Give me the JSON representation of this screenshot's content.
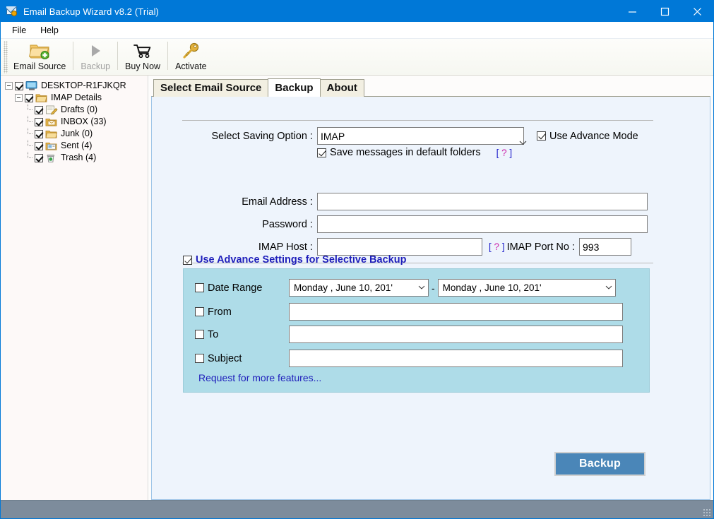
{
  "window": {
    "title": "Email Backup Wizard v8.2 (Trial)",
    "icon": "envelope-app-icon",
    "minimize": "minimize-icon",
    "maximize": "maximize-icon",
    "close": "close-icon",
    "accent_color": "#0078d7"
  },
  "menu": {
    "items": [
      {
        "label": "File"
      },
      {
        "label": "Help"
      }
    ]
  },
  "toolbar": {
    "buttons": [
      {
        "label": "Email Source",
        "icon": "folder-add-icon",
        "disabled": false
      },
      {
        "label": "Backup",
        "icon": "play-triangle-icon",
        "disabled": true
      },
      {
        "label": "Buy Now",
        "icon": "shopping-cart-icon",
        "disabled": false
      },
      {
        "label": "Activate",
        "icon": "key-icon",
        "disabled": false
      }
    ]
  },
  "sidebar": {
    "tree": [
      {
        "label": "DESKTOP-R1FJKQR",
        "icon": "computer-icon",
        "checked": true,
        "level": 0,
        "expander": true
      },
      {
        "label": "IMAP Details",
        "icon": "folders-icon",
        "checked": true,
        "level": 1,
        "expander": true
      },
      {
        "label": "Drafts (0)",
        "icon": "drafts-icon",
        "checked": true,
        "level": 2,
        "expander": false
      },
      {
        "label": "INBOX (33)",
        "icon": "inbox-icon",
        "checked": true,
        "level": 2,
        "expander": false
      },
      {
        "label": "Junk (0)",
        "icon": "folder-icon",
        "checked": true,
        "level": 2,
        "expander": false
      },
      {
        "label": "Sent (4)",
        "icon": "sent-icon",
        "checked": true,
        "level": 2,
        "expander": false
      },
      {
        "label": "Trash (4)",
        "icon": "trash-icon",
        "checked": true,
        "level": 2,
        "expander": false
      }
    ]
  },
  "tabs": [
    {
      "label": "Select Email Source",
      "active": false
    },
    {
      "label": "Backup",
      "active": true
    },
    {
      "label": "About",
      "active": false
    }
  ],
  "form": {
    "saving_option_label": "Select Saving Option :",
    "saving_option_value": "IMAP",
    "use_advance_mode_label": "Use Advance Mode",
    "use_advance_mode_checked": true,
    "save_default_folders_label": "Save messages in default folders",
    "save_default_folders_checked": true,
    "help_bracket_open": "[",
    "help_question": "?",
    "help_bracket_close": "]",
    "email_label": "Email Address :",
    "email_value": "",
    "password_label": "Password :",
    "password_value": "",
    "imap_host_label": "IMAP Host :",
    "imap_host_value": "",
    "imap_port_label": "IMAP Port No :",
    "imap_port_value": "993"
  },
  "advance": {
    "header_label": "Use Advance Settings for Selective Backup",
    "header_checked": true,
    "date_range_label": "Date Range",
    "date_range_checked": false,
    "date_from": "Monday    ,    June      10, 201'",
    "date_to": "Monday    ,    June      10, 201'",
    "date_separator": "-",
    "from_label": "From",
    "from_checked": false,
    "from_value": "",
    "to_label": "To",
    "to_checked": false,
    "to_value": "",
    "subject_label": "Subject",
    "subject_checked": false,
    "subject_value": "",
    "request_link": "Request for more features...",
    "panel_color": "#aedce8"
  },
  "actions": {
    "backup_button": "Backup",
    "backup_button_color": "#4a86b8"
  }
}
